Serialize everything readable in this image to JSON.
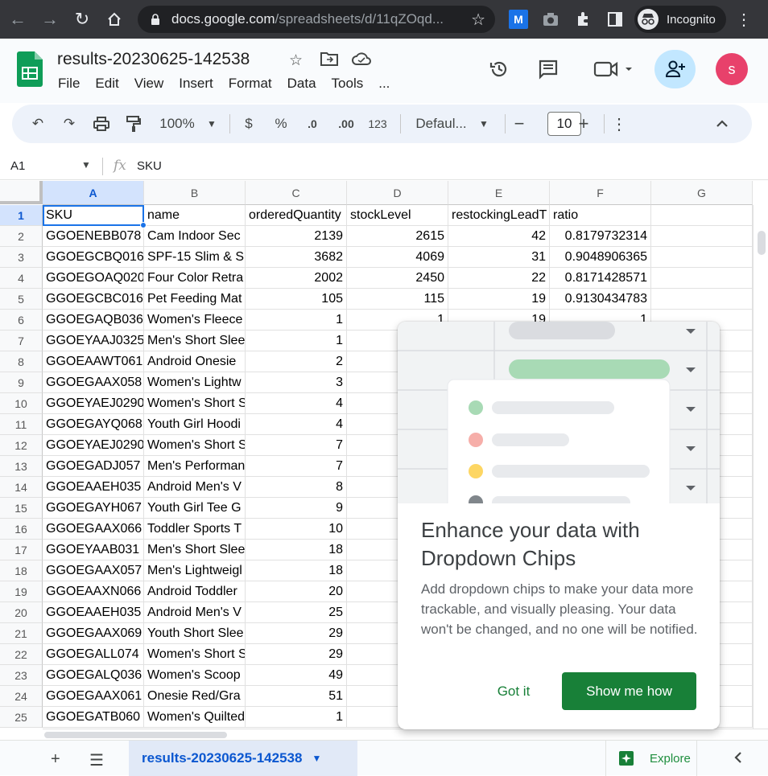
{
  "browser": {
    "url_host": "docs.google.com",
    "url_path": "/spreadsheets/d/11qZOqd...",
    "profile_label": "Incognito"
  },
  "doc": {
    "title": "results-20230625-142538",
    "menu": [
      "File",
      "Edit",
      "View",
      "Insert",
      "Format",
      "Data",
      "Tools",
      "..."
    ],
    "avatar_letter": "s"
  },
  "toolbar": {
    "zoom": "100%",
    "currency": "$",
    "percent": "%",
    "decrease_decimal": ".0",
    "increase_decimal": ".00",
    "number_format": "123",
    "font": "Defaul...",
    "font_size": "10"
  },
  "formula": {
    "name_box": "A1",
    "fx": "fx",
    "value": "SKU"
  },
  "columns": [
    "A",
    "B",
    "C",
    "D",
    "E",
    "F",
    "G"
  ],
  "rows": [
    {
      "n": "1",
      "cells": [
        "SKU",
        "name",
        "orderedQuantity",
        "stockLevel",
        "restockingLeadT",
        "ratio",
        ""
      ]
    },
    {
      "n": "2",
      "cells": [
        "GGOENEBB078",
        "Cam Indoor Sec",
        "2139",
        "2615",
        "42",
        "0.8179732314",
        ""
      ]
    },
    {
      "n": "3",
      "cells": [
        "GGOEGCBQ016",
        "SPF-15 Slim & S",
        "3682",
        "4069",
        "31",
        "0.9048906365",
        ""
      ]
    },
    {
      "n": "4",
      "cells": [
        "GGOEGOAQ020",
        "Four Color Retra",
        "2002",
        "2450",
        "22",
        "0.8171428571",
        ""
      ]
    },
    {
      "n": "5",
      "cells": [
        "GGOEGCBC016",
        "Pet Feeding Mat",
        "105",
        "115",
        "19",
        "0.9130434783",
        ""
      ]
    },
    {
      "n": "6",
      "cells": [
        "GGOEGAQB036",
        "Women's Fleece",
        "1",
        "1",
        "19",
        "1",
        ""
      ]
    },
    {
      "n": "7",
      "cells": [
        "GGOEYAAJ0325",
        "Men's Short Slee",
        "1",
        "",
        "",
        "",
        ""
      ]
    },
    {
      "n": "8",
      "cells": [
        "GGOEAAWT061",
        "Android Onesie",
        "2",
        "",
        "",
        "",
        ""
      ]
    },
    {
      "n": "9",
      "cells": [
        "GGOEGAAX058",
        "Women's Lightw",
        "3",
        "",
        "",
        "",
        ""
      ]
    },
    {
      "n": "10",
      "cells": [
        "GGOEYAEJ0290",
        "Women's Short S",
        "4",
        "",
        "",
        "",
        ""
      ]
    },
    {
      "n": "11",
      "cells": [
        "GGOEGAYQ068",
        "Youth Girl Hoodi",
        "4",
        "",
        "",
        "",
        ""
      ]
    },
    {
      "n": "12",
      "cells": [
        "GGOEYAEJ0290",
        "Women's Short S",
        "7",
        "",
        "",
        "",
        ""
      ]
    },
    {
      "n": "13",
      "cells": [
        "GGOEGADJ057",
        "Men's Performan",
        "7",
        "",
        "",
        "",
        ""
      ]
    },
    {
      "n": "14",
      "cells": [
        "GGOEAAEH035",
        "Android Men's V",
        "8",
        "",
        "",
        "",
        ""
      ]
    },
    {
      "n": "15",
      "cells": [
        "GGOEGAYH067",
        "Youth Girl Tee G",
        "9",
        "",
        "",
        "",
        ""
      ]
    },
    {
      "n": "16",
      "cells": [
        "GGOEGAAX066",
        "Toddler Sports T",
        "10",
        "",
        "",
        "",
        ""
      ]
    },
    {
      "n": "17",
      "cells": [
        "GGOEYAAB031",
        "Men's Short Slee",
        "18",
        "",
        "",
        "",
        ""
      ]
    },
    {
      "n": "18",
      "cells": [
        "GGOEGAAX057",
        "Men's Lightweigl",
        "18",
        "",
        "",
        "",
        ""
      ]
    },
    {
      "n": "19",
      "cells": [
        "GGOEAAXN066",
        "Android Toddler",
        "20",
        "",
        "",
        "",
        ""
      ]
    },
    {
      "n": "20",
      "cells": [
        "GGOEAAEH035",
        "Android Men's V",
        "25",
        "",
        "",
        "",
        ""
      ]
    },
    {
      "n": "21",
      "cells": [
        "GGOEGAAX069",
        "Youth Short Slee",
        "29",
        "",
        "",
        "",
        ""
      ]
    },
    {
      "n": "22",
      "cells": [
        "GGOEGALL074",
        "Women's Short S",
        "29",
        "",
        "",
        "",
        ""
      ]
    },
    {
      "n": "23",
      "cells": [
        "GGOEGALQ036",
        "Women's Scoop",
        "49",
        "",
        "",
        "",
        ""
      ]
    },
    {
      "n": "24",
      "cells": [
        "GGOEGAAX061",
        "Onesie Red/Gra",
        "51",
        "",
        "",
        "",
        ""
      ]
    },
    {
      "n": "25",
      "cells": [
        "GGOEGATB060",
        "Women's Quilted",
        "1",
        "",
        "",
        "",
        ""
      ]
    }
  ],
  "sheets": {
    "active_tab": "results-20230625-142538",
    "explore_label": "Explore"
  },
  "popup": {
    "title": "Enhance your data with Dropdown Chips",
    "body": "Add dropdown chips to make your data more trackable, and visually pleasing. Your data won't be changed, and no one will be notified.",
    "dismiss_label": "Got it",
    "action_label": "Show me how"
  },
  "colors": {
    "accent": "#1a73e8",
    "sheets_green": "#188038",
    "selected_header": "#d3e3fd"
  }
}
